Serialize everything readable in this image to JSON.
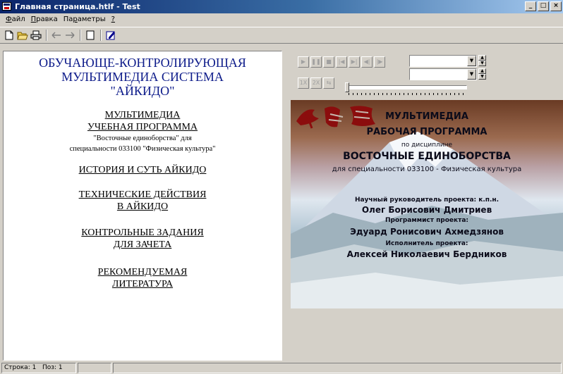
{
  "window": {
    "title": "Главная страница.htlf - Test",
    "buttons": {
      "minimize": "_",
      "maximize": "□",
      "close": "×"
    }
  },
  "menu": {
    "items": [
      {
        "hotkey": "Ф",
        "rest": "айл"
      },
      {
        "hotkey": "П",
        "rest": "равка"
      },
      {
        "hotkey": "",
        "pre": "Па",
        "hk2": "р",
        "rest": "аметры"
      },
      {
        "hotkey": "?",
        "rest": ""
      }
    ]
  },
  "toolbar": {
    "icons": [
      "new-icon",
      "open-icon",
      "print-icon",
      "back-icon",
      "forward-icon",
      "page-icon",
      "edit-icon"
    ]
  },
  "document": {
    "title_lines": [
      "ОБУЧАЮЩЕ-КОНТРОЛИРУЮЩАЯ",
      "МУЛЬТИМЕДИА  СИСТЕМА",
      "\"АЙКИДО\""
    ],
    "section1": {
      "link_line1": "МУЛЬТИМЕДИА   ",
      "link_line2": "УЧЕБНАЯ ПРОГРАММА",
      "sub_line1": "\"Восточные единоборства\" для",
      "sub_line2": "специальности 033100 \"Физическая культура\""
    },
    "section2": {
      "link": "ИСТОРИЯ И СУТЬ АЙКИДО"
    },
    "section3": {
      "link_line1": "ТЕХНИЧЕСКИЕ ДЕЙСТВИЯ",
      "link_line2": "В АЙКИДО"
    },
    "section4": {
      "link_line1": "КОНТРОЛЬНЫЕ ЗАДАНИЯ",
      "link_line2": "ДЛЯ ЗАЧЕТА"
    },
    "section5": {
      "link_line1": "РЕКОМЕНДУЕМАЯ",
      "link_line2": "ЛИТЕРАТУРА"
    }
  },
  "media": {
    "controls": [
      "play-icon",
      "pause-icon",
      "stop-icon",
      "first-frame-icon",
      "last-frame-icon",
      "step-back-icon",
      "step-forward-icon"
    ],
    "speed_buttons": [
      "1X",
      "2X",
      "⇆"
    ],
    "progress": 0.0,
    "video_text": {
      "line1": "МУЛЬТИМЕДИА",
      "line2": "РАБОЧАЯ ПРОГРАММА",
      "line3": "по дисциплине",
      "line4": "ВОСТОЧНЫЕ ЕДИНОБОРСТВА",
      "line5": "для специальности 033100 - Физическая культура",
      "line6": "Научный руководитель проекта: к.п.н.",
      "line7": "Олег Борисович Дмитриев",
      "line8": "Программист проекта:",
      "line9": "Эдуард Ронисович Ахмедзянов",
      "line10": "Исполнитель проекта:",
      "line11": "Алексей Николаевич Бердников"
    }
  },
  "status": {
    "line_label": "Строка:",
    "line_value": "1",
    "pos_label": "Поз:",
    "pos_value": "1"
  }
}
